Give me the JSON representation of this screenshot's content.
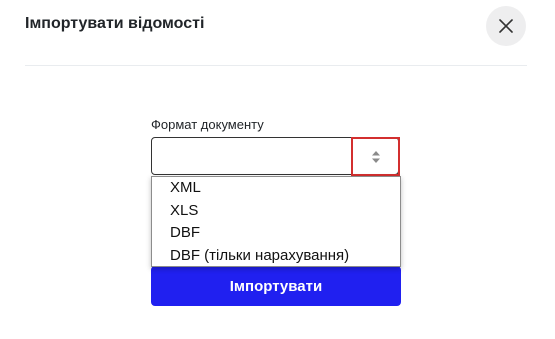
{
  "modal": {
    "title": "Імпортувати відомості"
  },
  "form": {
    "format_label": "Формат документу",
    "format_value": "",
    "options": [
      "XML",
      "XLS",
      "DBF",
      "DBF (тільки нарахування)"
    ],
    "submit_label": "Імпортувати"
  },
  "icons": {
    "close": "close-icon",
    "select_arrows": "sort-arrows-icon"
  },
  "colors": {
    "primary_button": "#2020f0",
    "highlight_border": "#d32f2f",
    "close_button_bg": "#eeeeef"
  }
}
